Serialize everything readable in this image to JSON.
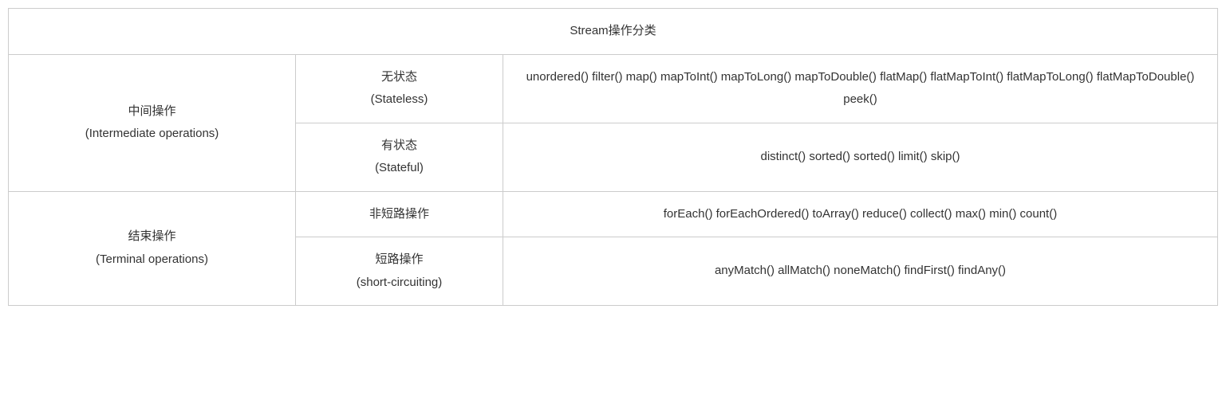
{
  "table": {
    "title": "Stream操作分类",
    "rows": [
      {
        "category_cn": "中间操作",
        "category_en": "(Intermediate operations)",
        "sub": [
          {
            "label_cn": "无状态",
            "label_en": "(Stateless)",
            "methods": "unordered() filter() map() mapToInt() mapToLong() mapToDouble() flatMap() flatMapToInt() flatMapToLong() flatMapToDouble() peek()"
          },
          {
            "label_cn": "有状态",
            "label_en": "(Stateful)",
            "methods": "distinct() sorted() sorted() limit() skip()"
          }
        ]
      },
      {
        "category_cn": "结束操作",
        "category_en": "(Terminal operations)",
        "sub": [
          {
            "label_cn": "非短路操作",
            "label_en": "",
            "methods": "forEach() forEachOrdered() toArray() reduce() collect() max() min() count()"
          },
          {
            "label_cn": "短路操作",
            "label_en": "(short-circuiting)",
            "methods": "anyMatch() allMatch() noneMatch() findFirst() findAny()"
          }
        ]
      }
    ]
  }
}
